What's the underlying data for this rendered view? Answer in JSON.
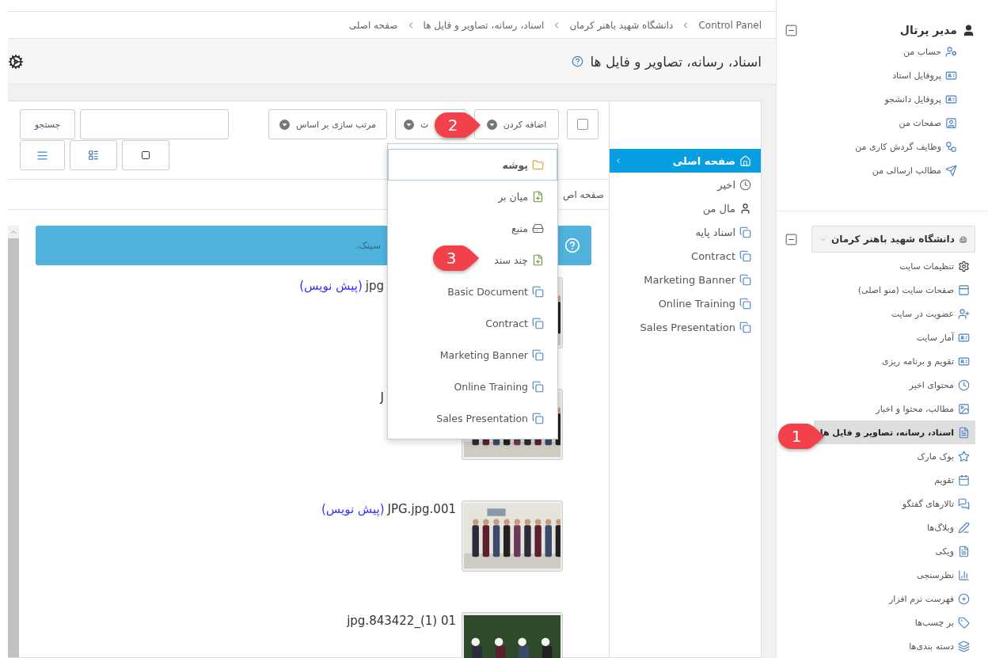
{
  "breadcrumb": [
    "Control Panel",
    "دانشگاه شهید باهنر کرمان",
    "اسناد، رسانه، تصاویر و فایل ها",
    "صفحه اصلی"
  ],
  "page_title": "اسناد، رسانه، تصاویر و فایل ها",
  "sidebar": {
    "portal": {
      "title": "مدیر پرتال",
      "items": [
        {
          "label": "حساب من",
          "selected": false
        },
        {
          "label": "پروفایل استاد",
          "selected": false
        },
        {
          "label": "پروفایل دانشجو",
          "selected": false
        },
        {
          "label": "صفحات من",
          "selected": false
        },
        {
          "label": "وظایف گردش کاری من",
          "selected": false
        },
        {
          "label": "مطالب ارسالی من",
          "selected": false
        }
      ]
    },
    "site": {
      "title": "دانشگاه شهید باهنر کرمان",
      "items": [
        {
          "label": "تنظیمات سایت",
          "selected": false
        },
        {
          "label": "صفحات سایت (منو اصلی)",
          "selected": false
        },
        {
          "label": "عضویت در سایت",
          "selected": false
        },
        {
          "label": "آمار سایت",
          "selected": false
        },
        {
          "label": "تقویم و برنامه ریزی",
          "selected": false
        },
        {
          "label": "محتوای اخیر",
          "selected": false
        },
        {
          "label": "مطالب، محتوا و اخبار",
          "selected": false
        },
        {
          "label": "اسناد، رسانه، تصاویر و فایل ها",
          "selected": true
        },
        {
          "label": "بوک مارک",
          "selected": false
        },
        {
          "label": "تقویم",
          "selected": false
        },
        {
          "label": "تالارهای گفتگو",
          "selected": false
        },
        {
          "label": "وبلاگ‌ها",
          "selected": false
        },
        {
          "label": "ویکی",
          "selected": false
        },
        {
          "label": "نظرسنجی",
          "selected": false
        },
        {
          "label": "فهرست نرم افزار",
          "selected": false
        },
        {
          "label": "بر چسب‌ها",
          "selected": false
        },
        {
          "label": "دسته بندی‌ها",
          "selected": false
        }
      ]
    }
  },
  "folder_nav": {
    "items": [
      {
        "label": "صفحه اصلی",
        "selected": true
      },
      {
        "label": "اخیر",
        "selected": false
      },
      {
        "label": "مال من",
        "selected": false
      },
      {
        "label": "اسناد پایه",
        "selected": false
      },
      {
        "label": "Contract",
        "selected": false
      },
      {
        "label": "Marketing Banner",
        "selected": false
      },
      {
        "label": "Online Training",
        "selected": false
      },
      {
        "label": "Sales Presentation",
        "selected": false
      }
    ]
  },
  "toolbar": {
    "select_all": {
      "checked": false
    },
    "add_button": "اضافه کردن",
    "view_button": "ت",
    "sort_button": "مرتب سازی بر اساس",
    "search_button": "جستجو"
  },
  "path": "صفحه اص",
  "info_alert": "سینک.",
  "entries": [
    {
      "kind": "partly-hidden",
      "title": "jpg",
      "draft": "(پیش نویس)"
    },
    {
      "kind": "partly-hidden",
      "title": "J"
    },
    {
      "kind": "file",
      "title": "JPG.jpg.001",
      "draft": "(پیش نویس)"
    },
    {
      "kind": "file",
      "title": "jpg.843422_(1) 01"
    }
  ],
  "add_menu": {
    "items": [
      {
        "label": "پوشه",
        "selected": true
      },
      {
        "label": "میان بر",
        "selected": false
      },
      {
        "label": "منبع",
        "selected": false
      },
      {
        "label": "چند سند",
        "selected": false
      },
      {
        "label": "Basic Document",
        "selected": false
      },
      {
        "label": "Contract",
        "selected": false
      },
      {
        "label": "Marketing Banner",
        "selected": false
      },
      {
        "label": "Online Training",
        "selected": false
      },
      {
        "label": "Sales Presentation",
        "selected": false
      }
    ]
  },
  "callouts": [
    "1",
    "2",
    "3"
  ]
}
